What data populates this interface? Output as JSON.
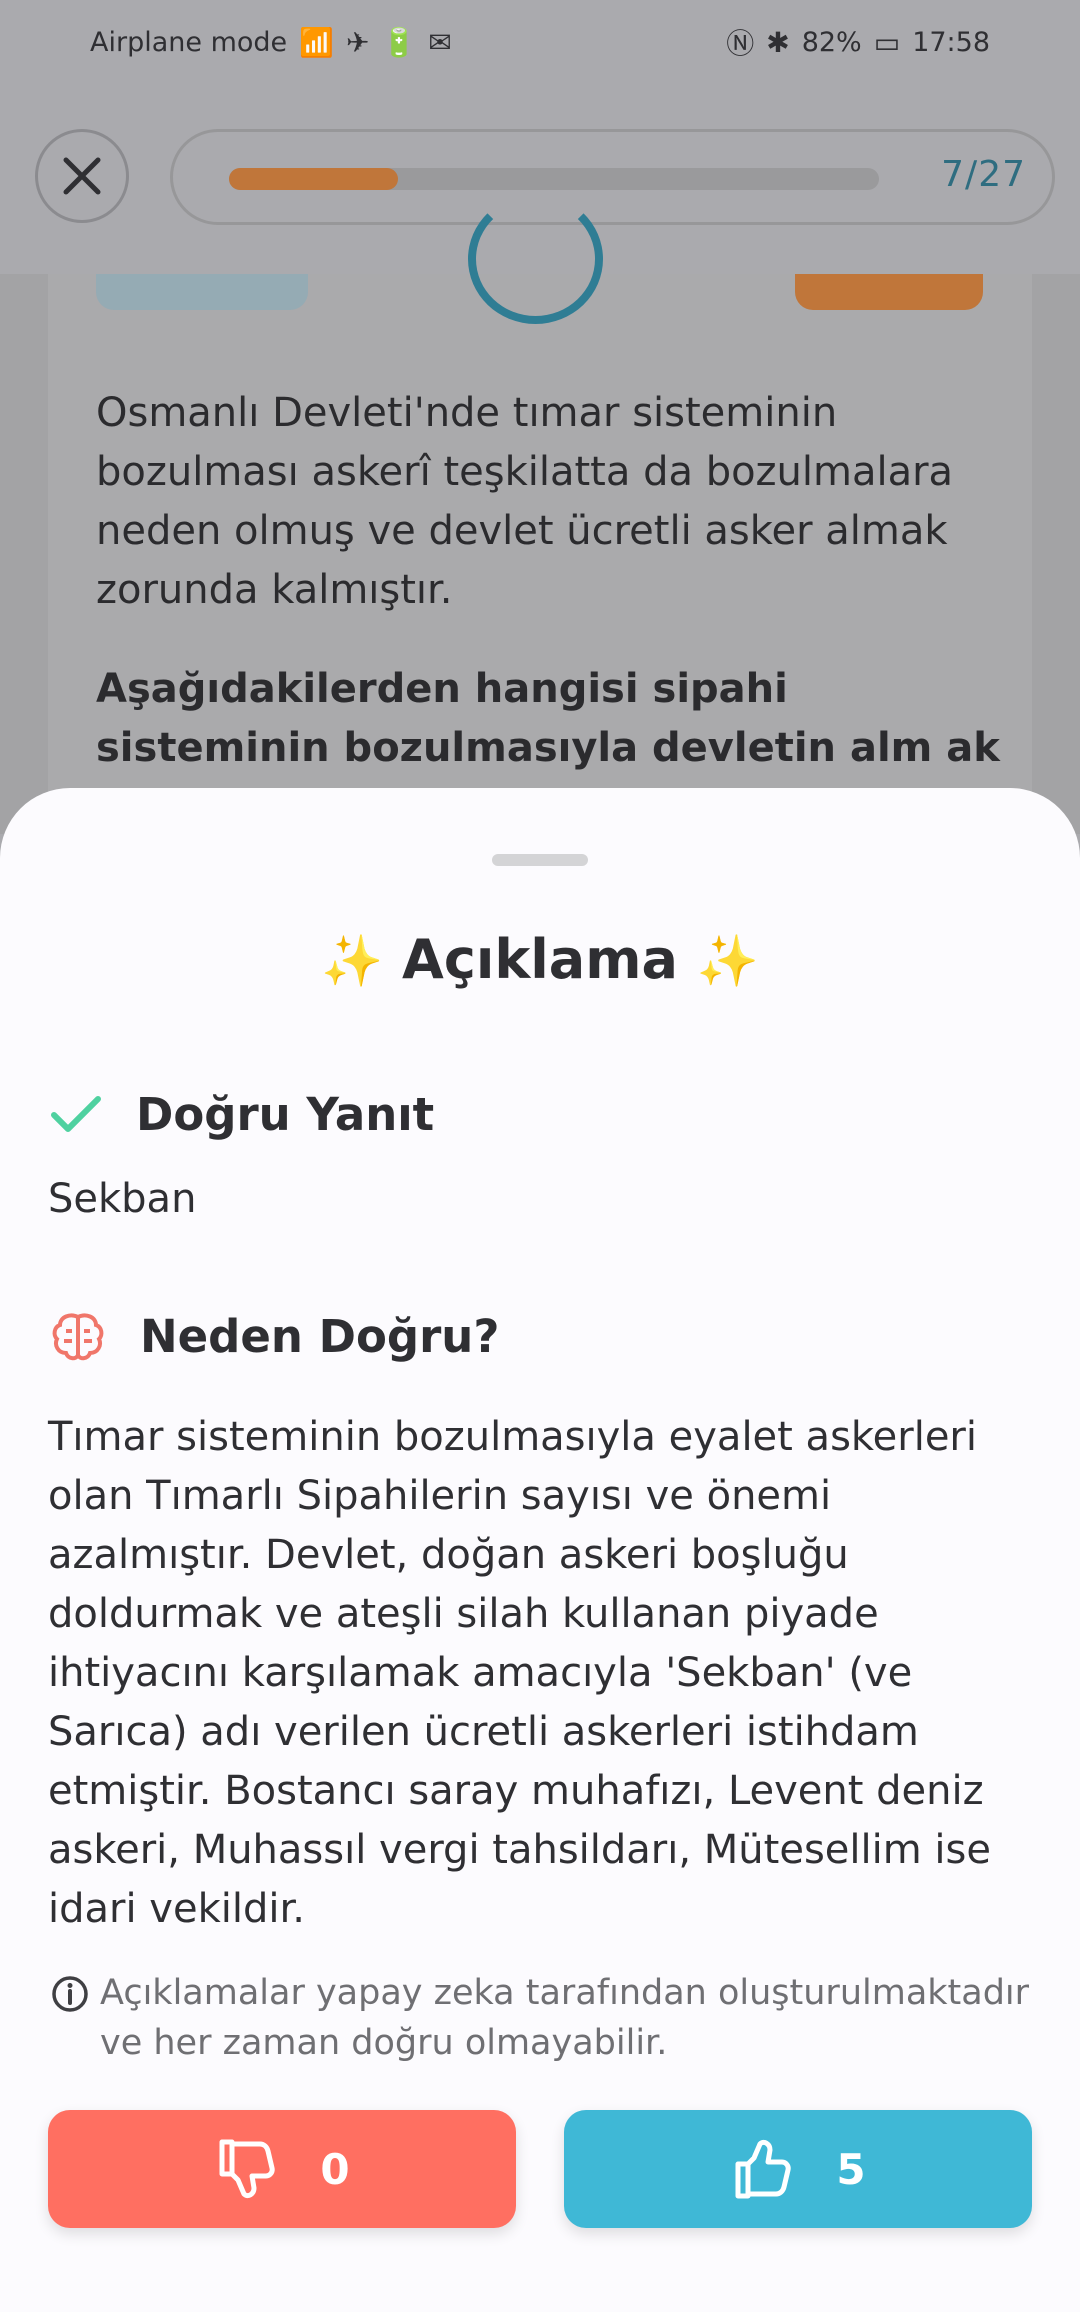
{
  "status_bar": {
    "carrier": "Airplane mode",
    "battery": "82%",
    "time": "17:58"
  },
  "header": {
    "progress_counter": "7/27",
    "progress_fraction": 0.26
  },
  "question": {
    "text": "Osmanlı Devleti'nde tımar sisteminin bozulması askerî teşkilatta da bozulmalara neden olmuş ve devlet ücretli asker almak zorunda kalmıştır.",
    "prompt": "Aşağıdakilerden hangisi sipahi sisteminin bozulmasıyla devletin alm ak"
  },
  "sheet": {
    "title": "Açıklama",
    "correct_title": "Doğru Yanıt",
    "correct_answer": "Sekban",
    "why_title": "Neden Doğru?",
    "explanation": "Tımar sisteminin bozulmasıyla eyalet askerleri olan Tımarlı Sipahilerin sayısı ve önemi azalmıştır. Devlet, doğan askeri boşluğu doldurmak ve ateşli silah kullanan piyade ihtiyacını karşılamak amacıyla 'Sekban' (ve Sarıca) adı verilen ücretli askerleri istihdam etmiştir. Bostancı saray muhafızı, Levent deniz askeri, Muhassıl vergi tahsildarı, Mütesellim ise idari vekildir.",
    "disclaimer": "Açıklamalar yapay zeka tarafından oluşturulmaktadır ve her zaman doğru olmayabilir.",
    "dislike_count": "0",
    "like_count": "5"
  },
  "colors": {
    "accent_orange": "#c0763a",
    "dislike": "#ff6f61",
    "like": "#3fb8d6",
    "check": "#4fd1a0",
    "brain": "#f0766a"
  }
}
